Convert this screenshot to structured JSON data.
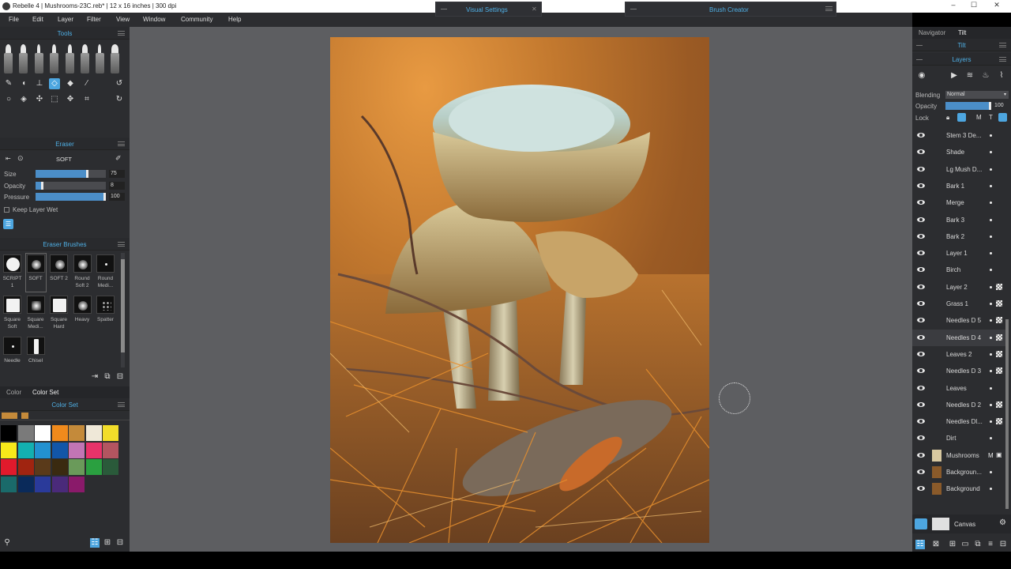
{
  "window": {
    "title": "Rebelle 4 | Mushrooms-23C.reb* | 12 x 16 inches | 300 dpi",
    "minimize": "–",
    "maximize": "☐",
    "close": "✕"
  },
  "menu": [
    "File",
    "Edit",
    "Layer",
    "Filter",
    "View",
    "Window",
    "Community",
    "Help"
  ],
  "floating": {
    "visual_settings": "Visual Settings",
    "brush_creator": "Brush Creator"
  },
  "tools_panel": {
    "title": "Tools"
  },
  "eraser_panel": {
    "title": "Eraser",
    "mode": "SOFT",
    "size_label": "Size",
    "size_value": "75",
    "opacity_label": "Opacity",
    "opacity_value": "8",
    "pressure_label": "Pressure",
    "pressure_value": "100",
    "keep_wet": "Keep Layer Wet"
  },
  "eraser_brushes": {
    "title": "Eraser Brushes",
    "items": [
      [
        "SCRIPT",
        "1"
      ],
      [
        "SOFT",
        ""
      ],
      [
        "SOFT 2",
        ""
      ],
      [
        "Round",
        "Soft 2"
      ],
      [
        "Round",
        "Medi..."
      ],
      [
        "Square",
        "Soft"
      ],
      [
        "Square",
        "Medi..."
      ],
      [
        "Square",
        "Hard"
      ],
      [
        "Heavy",
        ""
      ],
      [
        "Spatter",
        ""
      ],
      [
        "Needle",
        ""
      ],
      [
        "Chisel",
        ""
      ]
    ]
  },
  "color_tabs": {
    "color": "Color",
    "color_set": "Color Set"
  },
  "color_set": {
    "title": "Color Set",
    "swatches": [
      "#000000",
      "#7a7a7a",
      "#ffffff",
      "#f08a1c",
      "#c48a3a",
      "#efe8d8",
      "#f2dd2a",
      "#f7e81a",
      "#13b0b0",
      "#2291d0",
      "#1256a8",
      "#c275b4",
      "#e8336a",
      "#b35560",
      "#e01a2c",
      "#a02410",
      "#5a3a1a",
      "#3a2a10",
      "#6a9a5a",
      "#2aa040",
      "#2a5a3a",
      "#1a6a6a",
      "#0a2a5a",
      "#2a3a9a",
      "#4a2a7a",
      "#8a1a6a"
    ]
  },
  "right_tabs": {
    "navigator": "Navigator",
    "tilt": "Tilt"
  },
  "tilt_panel": {
    "title": "Tilt"
  },
  "layers_panel": {
    "title": "Layers",
    "blending_label": "Blending",
    "blending_value": "Normal",
    "opacity_label": "Opacity",
    "opacity_value": "100",
    "lock_label": "Lock",
    "lock_m": "M",
    "lock_t": "T",
    "layers": [
      "Stem 3 De...",
      "Shade",
      "Lg Mush D...",
      "Bark 1",
      "Merge",
      "Bark 3",
      "Bark 2",
      "Layer 1",
      "Birch",
      "Layer 2",
      "Grass 1",
      "Needles D 5",
      "Needles D 4",
      "Leaves 2",
      "Needles D 3",
      "Leaves",
      "Needles D 2",
      "Needles Dl...",
      "Dirt",
      "Mushrooms",
      "Backgroun...",
      "Background"
    ],
    "mushrooms_flag": "M",
    "canvas_label": "Canvas"
  }
}
